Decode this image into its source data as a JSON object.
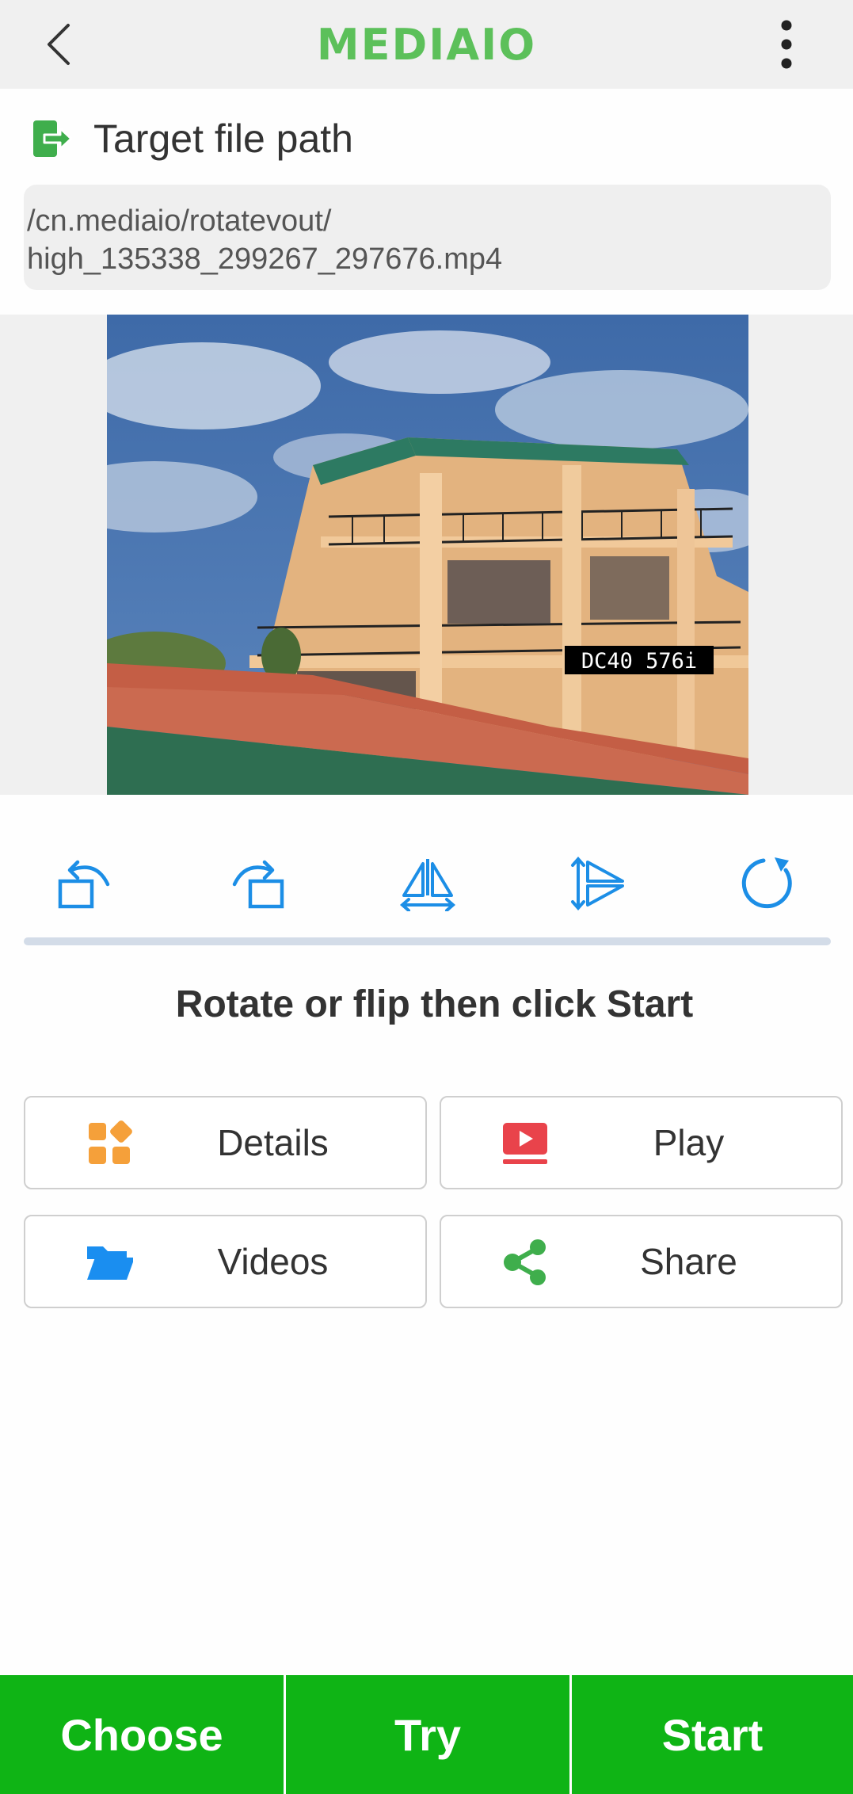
{
  "app": {
    "brand": "MEDIAIO"
  },
  "target": {
    "label": "Target file path",
    "path_line1": "/cn.mediaio/rotatevout/",
    "path_line2": "high_135338_299267_297676.mp4"
  },
  "preview": {
    "overlay_text": "DC40 576i"
  },
  "tools": [
    "rotate-left-icon",
    "rotate-right-icon",
    "flip-horizontal-icon",
    "flip-vertical-icon",
    "reset-icon"
  ],
  "hint": "Rotate or flip then click Start",
  "actions": {
    "details": {
      "label": "Details",
      "icon": "details-icon",
      "color": "#f5a03a"
    },
    "play": {
      "label": "Play",
      "icon": "play-icon",
      "color": "#e9434b"
    },
    "videos": {
      "label": "Videos",
      "icon": "folder-icon",
      "color": "#1a8ef0"
    },
    "share": {
      "label": "Share",
      "icon": "share-icon",
      "color": "#3fae4c"
    }
  },
  "bottom": {
    "choose": "Choose",
    "try": "Try",
    "start": "Start"
  },
  "colors": {
    "accent": "#0fb415",
    "tool_blue": "#1c8ee6",
    "brand_green": "#5cc05a"
  }
}
